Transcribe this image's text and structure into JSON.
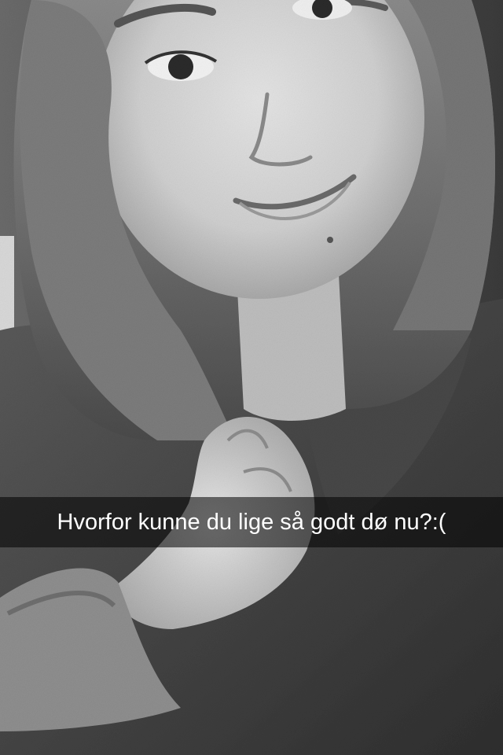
{
  "snap": {
    "caption": "Hvorfor kunne du lige så godt dø nu?:("
  },
  "colors": {
    "caption_text": "#ffffff",
    "caption_bar": "#000000",
    "photo_tone": "grayscale"
  }
}
